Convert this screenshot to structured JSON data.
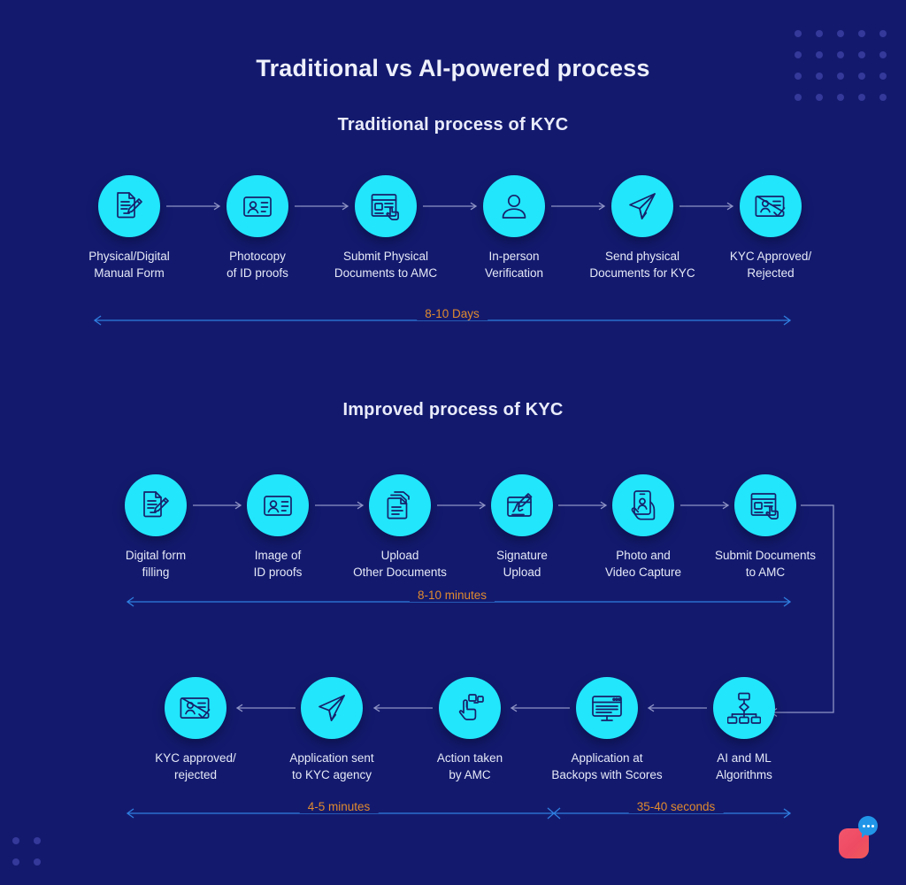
{
  "main_title": "Traditional vs AI-powered process",
  "sections": [
    {
      "heading": "Traditional process of KYC"
    },
    {
      "heading": "Improved process of KYC"
    }
  ],
  "colors": {
    "background": "#131a6e",
    "icon_circle": "#22e6fb",
    "icon_stroke": "#17216b",
    "arrow": "#8e93c4",
    "timeline_line": "#2f7fe0",
    "timeline_label": "#e08a2e",
    "dot": "#34399a",
    "text": "#e6e9f7",
    "widget_square": "#ee4b63",
    "widget_bubble": "#2196e8"
  },
  "traditional_row": [
    {
      "icon": "document-pencil-icon",
      "label": "Physical/Digital\nManual Form"
    },
    {
      "icon": "id-card-icon",
      "label": "Photocopy\nof ID proofs"
    },
    {
      "icon": "document-hand-icon",
      "label": "Submit Physical\nDocuments to AMC"
    },
    {
      "icon": "person-icon",
      "label": "In-person\nVerification"
    },
    {
      "icon": "paper-plane-icon",
      "label": "Send physical\nDocuments for KYC"
    },
    {
      "icon": "id-card-check-icon",
      "label": "KYC Approved/\nRejected"
    }
  ],
  "improved_row_1": [
    {
      "icon": "document-pencil-icon",
      "label": "Digital form\nfilling"
    },
    {
      "icon": "id-card-icon",
      "label": "Image of\nID proofs"
    },
    {
      "icon": "documents-stack-icon",
      "label": "Upload\nOther Documents"
    },
    {
      "icon": "signature-pad-icon",
      "label": "Signature\nUpload"
    },
    {
      "icon": "phone-selfie-icon",
      "label": "Photo and\nVideo Capture"
    },
    {
      "icon": "document-hand-icon",
      "label": "Submit Documents\nto AMC"
    }
  ],
  "improved_row_2": [
    {
      "icon": "id-card-check-icon",
      "label": "KYC approved/\nrejected"
    },
    {
      "icon": "paper-plane-icon",
      "label": "Application sent\nto KYC agency"
    },
    {
      "icon": "hand-click-icon",
      "label": "Action taken\nby AMC"
    },
    {
      "icon": "monitor-icon",
      "label": "Application at\nBackops with Scores"
    },
    {
      "icon": "flowchart-ai-icon",
      "label": "AI and ML\nAlgorithms"
    }
  ],
  "timelines": [
    {
      "id": "traditional-duration",
      "label": "8-10 Days"
    },
    {
      "id": "improved-phase1-duration",
      "label": "8-10 minutes"
    },
    {
      "id": "improved-phase2-duration",
      "label": "4-5 minutes"
    },
    {
      "id": "improved-phase3-duration",
      "label": "35-40 seconds"
    }
  ],
  "chat_widget": {
    "name": "chat-widget"
  }
}
